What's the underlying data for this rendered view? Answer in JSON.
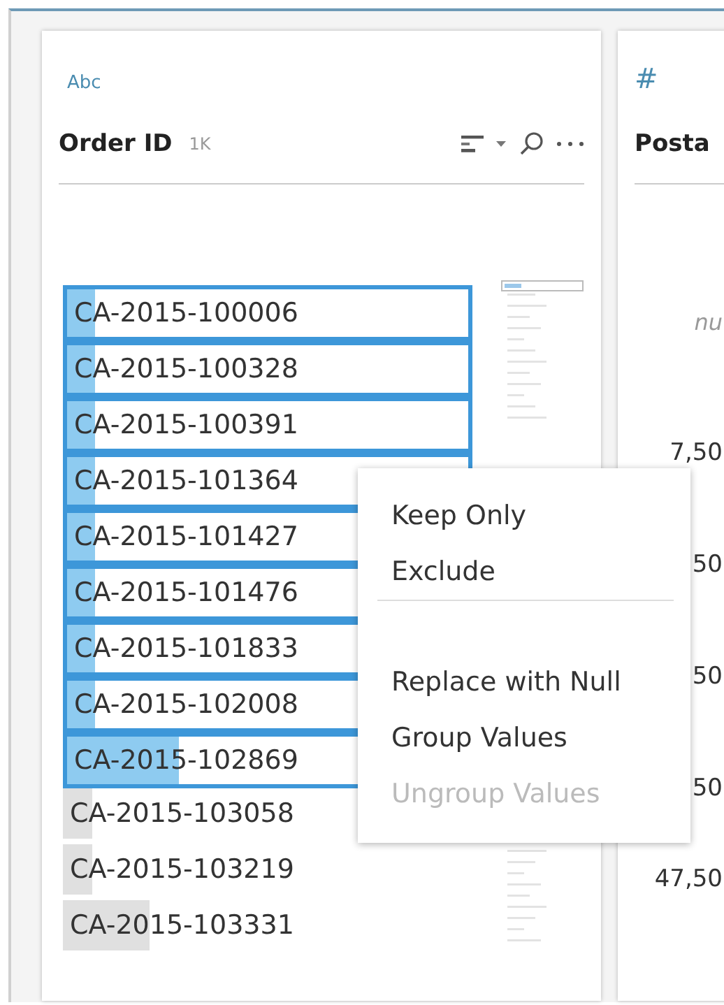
{
  "field_card": {
    "type_label": "Abc",
    "title": "Order ID",
    "count": "1K",
    "rows": [
      {
        "value": "CA-2015-100006",
        "selected": true,
        "level": 0.07
      },
      {
        "value": "CA-2015-100328",
        "selected": true,
        "level": 0.07
      },
      {
        "value": "CA-2015-100391",
        "selected": true,
        "level": 0.07
      },
      {
        "value": "CA-2015-101364",
        "selected": true,
        "level": 0.07
      },
      {
        "value": "CA-2015-101427",
        "selected": true,
        "level": 0.07
      },
      {
        "value": "CA-2015-101476",
        "selected": true,
        "level": 0.07
      },
      {
        "value": "CA-2015-101833",
        "selected": true,
        "level": 0.07
      },
      {
        "value": "CA-2015-102008",
        "selected": true,
        "level": 0.07
      },
      {
        "value": "CA-2015-102869",
        "selected": true,
        "level": 0.28
      },
      {
        "value": "CA-2015-103058",
        "selected": false,
        "level": 0.07
      },
      {
        "value": "CA-2015-103219",
        "selected": false,
        "level": 0.07
      },
      {
        "value": "CA-2015-103331",
        "selected": false,
        "level": 0.21
      }
    ]
  },
  "next_card": {
    "type_label": "#",
    "title": "Posta",
    "values": [
      {
        "text": "nu",
        "kind": "null"
      },
      {
        "text": "7,50",
        "kind": "value"
      },
      {
        "text": "50",
        "kind": "value"
      },
      {
        "text": "50",
        "kind": "value"
      },
      {
        "text": "50",
        "kind": "value"
      },
      {
        "text": "47,50",
        "kind": "value"
      }
    ]
  },
  "context_menu": {
    "items": [
      {
        "label": "Keep Only",
        "disabled": false
      },
      {
        "label": "Exclude",
        "disabled": false
      },
      {
        "kind": "separator"
      },
      {
        "label": "Replace with Null",
        "disabled": false
      },
      {
        "label": "Group Values",
        "disabled": false
      },
      {
        "label": "Ungroup Values",
        "disabled": true
      }
    ]
  }
}
